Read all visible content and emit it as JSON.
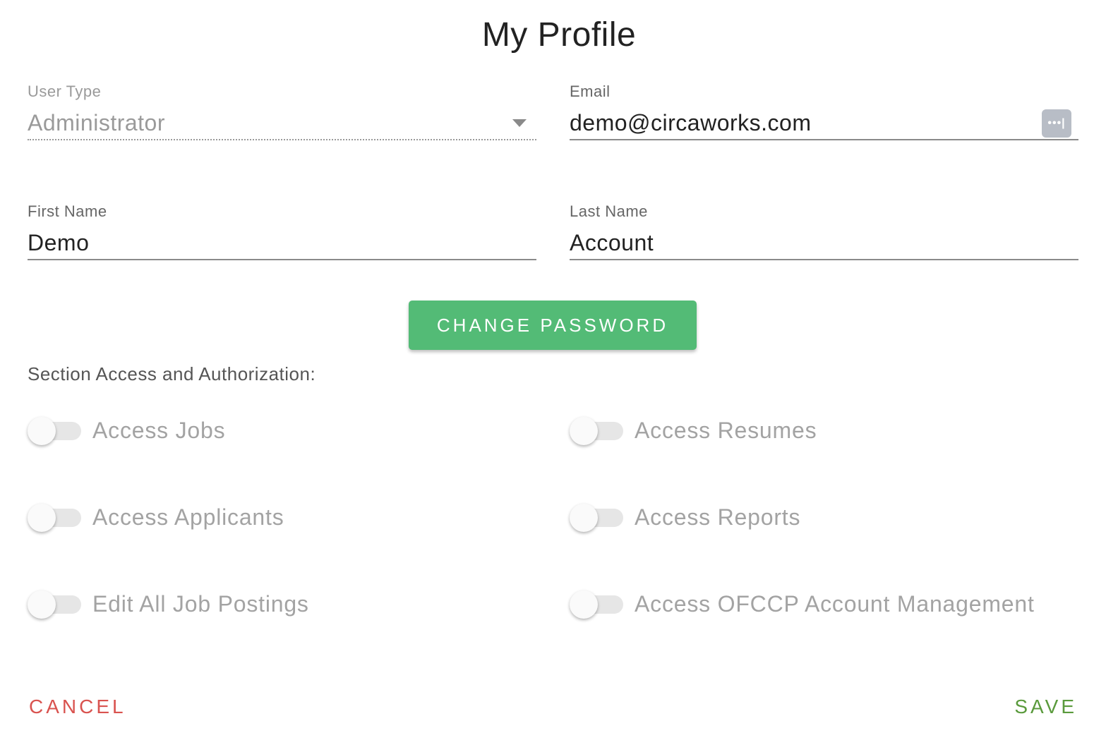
{
  "page": {
    "title": "My Profile"
  },
  "form": {
    "user_type": {
      "label": "User Type",
      "value": "Administrator",
      "disabled": true
    },
    "email": {
      "label": "Email",
      "value": "demo@circaworks.com",
      "icon": "password-manager-icon"
    },
    "first_name": {
      "label": "First Name",
      "value": "Demo"
    },
    "last_name": {
      "label": "Last Name",
      "value": "Account"
    }
  },
  "change_password_label": "CHANGE PASSWORD",
  "section": {
    "label": "Section Access and Authorization:",
    "toggles": [
      {
        "label": "Access Jobs",
        "checked": false
      },
      {
        "label": "Access Resumes",
        "checked": false
      },
      {
        "label": "Access Applicants",
        "checked": false
      },
      {
        "label": "Access Reports",
        "checked": false
      },
      {
        "label": "Edit All Job Postings",
        "checked": false
      },
      {
        "label": "Access OFCCP Account Management",
        "checked": false
      }
    ]
  },
  "footer": {
    "cancel_label": "CANCEL",
    "save_label": "SAVE"
  },
  "colors": {
    "primary_green": "#53bb76",
    "cancel_red": "#d9534f",
    "save_green": "#5a9a3c"
  }
}
